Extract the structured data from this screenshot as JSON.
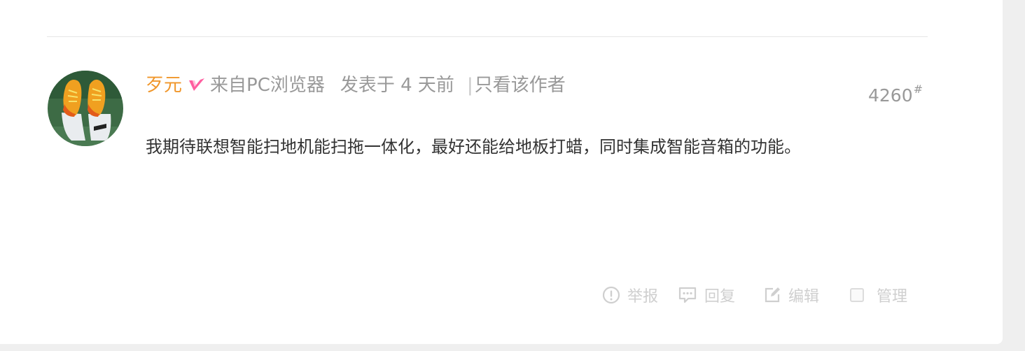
{
  "post": {
    "author": "歹元",
    "source": "来自PC浏览器",
    "posted": "发表于 4 天前",
    "separator": "|",
    "only_author": "只看该作者",
    "floor_number": "4260",
    "floor_mark": "#",
    "content": "我期待联想智能扫地机能扫拖一体化，最好还能给地板打蜡，同时集成智能音箱的功能。"
  },
  "actions": {
    "report": "举报",
    "reply": "回复",
    "edit": "编辑",
    "manage": "管理"
  },
  "colors": {
    "author": "#f0962a",
    "vip_badge": "#ff5fa0",
    "muted_text": "#999999",
    "content_text": "#333333",
    "action_text": "#cfcfcf"
  },
  "icons": {
    "avatar": "avatar-football-boots-image",
    "vip": "vip-badge-icon",
    "report": "exclamation-circle-icon",
    "reply": "speech-bubble-icon",
    "edit": "pencil-square-icon",
    "manage": "checkbox-icon"
  }
}
